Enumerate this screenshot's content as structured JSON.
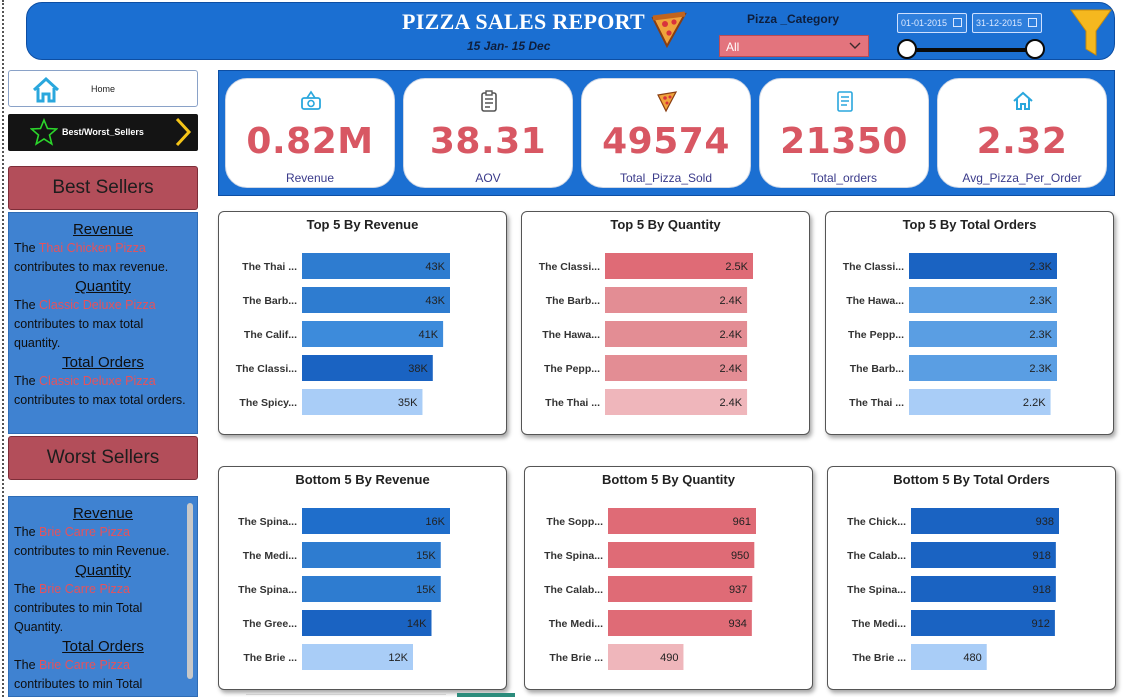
{
  "header": {
    "title": "PIZZA SALES REPORT",
    "subtitle": "15 Jan- 15 Dec",
    "category_label": "Pizza _Category",
    "category_value": "All",
    "date_start": "01-01-2015",
    "date_end": "31-12-2015",
    "colors": {
      "bar": "#1b6fd2",
      "accent": "#d85763"
    }
  },
  "nav": {
    "home_label": "Home",
    "best_worst_label": "Best/Worst_Sellers"
  },
  "best": {
    "heading": "Best Sellers",
    "revenue_title": "Revenue",
    "revenue_pre": "The ",
    "revenue_pizza": "Thai Chicken Pizza",
    "revenue_post": " contributes to max revenue.",
    "quantity_title": "Quantity",
    "quantity_pre": "The ",
    "quantity_pizza": "Classic Deluxe Pizza",
    "quantity_post": " contributes to max total quantity.",
    "orders_title": "Total Orders",
    "orders_pre": "The ",
    "orders_pizza": "Classic Deluxe Pizza",
    "orders_post": " contributes to max total orders."
  },
  "worst": {
    "heading": "Worst Sellers",
    "revenue_title": "Revenue",
    "revenue_pre": "The ",
    "revenue_pizza": "Brie Carre Pizza",
    "revenue_post": " contributes to min Revenue.",
    "quantity_title": "Quantity",
    "quantity_pre": "The ",
    "quantity_pizza": "Brie Carre Pizza",
    "quantity_post": " contributes to min Total Quantity.",
    "orders_title": "Total Orders",
    "orders_pre": "The ",
    "orders_pizza": "Brie Carre Pizza",
    "orders_post": " contributes to min Total"
  },
  "kpis": [
    {
      "value": "0.82M",
      "label": "Revenue",
      "icon": "money-icon"
    },
    {
      "value": "38.31",
      "label": "AOV",
      "icon": "clipboard-icon"
    },
    {
      "value": "49574",
      "label": "Total_Pizza_Sold",
      "icon": "pizza-slice-icon"
    },
    {
      "value": "21350",
      "label": "Total_orders",
      "icon": "order-list-icon"
    },
    {
      "value": "2.32",
      "label": "Avg_Pizza_Per_Order",
      "icon": "home-icon"
    }
  ],
  "chart_data": [
    {
      "type": "bar",
      "title": "Top 5 By Revenue",
      "categories": [
        "The Thai ...",
        "The Barb...",
        "The Calif...",
        "The Classi...",
        "The Spicy..."
      ],
      "values": [
        43,
        43,
        41,
        38,
        35
      ],
      "data_labels": [
        "43K",
        "43K",
        "41K",
        "38K",
        "35K"
      ],
      "colors": [
        "#2e7cd0",
        "#2e7cd0",
        "#3d8bdb",
        "#1a63c2",
        "#a9cdf7"
      ]
    },
    {
      "type": "bar",
      "title": "Top 5 By Quantity",
      "categories": [
        "The Classi...",
        "The Barb...",
        "The Hawa...",
        "The Pepp...",
        "The Thai ..."
      ],
      "values": [
        2.5,
        2.4,
        2.4,
        2.4,
        2.4
      ],
      "data_labels": [
        "2.5K",
        "2.4K",
        "2.4K",
        "2.4K",
        "2.4K"
      ],
      "colors": [
        "#df6b76",
        "#e38d94",
        "#e38d94",
        "#e38d94",
        "#efb6bb"
      ]
    },
    {
      "type": "bar",
      "title": "Top 5 By Total Orders",
      "categories": [
        "The Classi...",
        "The Hawa...",
        "The Pepp...",
        "The Barb...",
        "The Thai ..."
      ],
      "values": [
        2.3,
        2.3,
        2.3,
        2.3,
        2.2
      ],
      "data_labels": [
        "2.3K",
        "2.3K",
        "2.3K",
        "2.3K",
        "2.2K"
      ],
      "colors": [
        "#1a63c2",
        "#5a9ee3",
        "#5a9ee3",
        "#5a9ee3",
        "#a9cdf7"
      ]
    },
    {
      "type": "bar",
      "title": "Bottom 5 By Revenue",
      "categories": [
        "The Spina...",
        "The Medi...",
        "The Spina...",
        "The Gree...",
        "The Brie ..."
      ],
      "values": [
        16,
        15,
        15,
        14,
        12
      ],
      "data_labels": [
        "16K",
        "15K",
        "15K",
        "14K",
        "12K"
      ],
      "colors": [
        "#1f6ecb",
        "#2e7cd0",
        "#2e7cd0",
        "#1a63c2",
        "#a9cdf7"
      ]
    },
    {
      "type": "bar",
      "title": "Bottom 5 By Quantity",
      "categories": [
        "The Sopp...",
        "The Spina...",
        "The Calab...",
        "The Medi...",
        "The Brie ..."
      ],
      "values": [
        961,
        950,
        937,
        934,
        490
      ],
      "data_labels": [
        "961",
        "950",
        "937",
        "934",
        "490"
      ],
      "colors": [
        "#df6b76",
        "#df6b76",
        "#df6b76",
        "#df6b76",
        "#efb6bb"
      ]
    },
    {
      "type": "bar",
      "title": "Bottom 5 By Total Orders",
      "categories": [
        "The Chick...",
        "The Calab...",
        "The Spina...",
        "The Medi...",
        "The Brie ..."
      ],
      "values": [
        938,
        918,
        918,
        912,
        480
      ],
      "data_labels": [
        "938",
        "918",
        "918",
        "912",
        "480"
      ],
      "colors": [
        "#1a63c2",
        "#1a63c2",
        "#1a63c2",
        "#1a63c2",
        "#a9cdf7"
      ]
    }
  ]
}
